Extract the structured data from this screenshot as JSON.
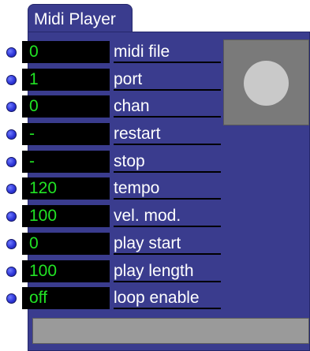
{
  "module": {
    "title": "Midi Player"
  },
  "parameters": [
    {
      "value": "0",
      "label": "midi file"
    },
    {
      "value": "1",
      "label": "port"
    },
    {
      "value": "0",
      "label": "chan"
    },
    {
      "value": "-",
      "label": "restart"
    },
    {
      "value": "-",
      "label": "stop"
    },
    {
      "value": "120",
      "label": "tempo"
    },
    {
      "value": "100",
      "label": "vel. mod."
    },
    {
      "value": "0",
      "label": "play start"
    },
    {
      "value": "100",
      "label": "play length"
    },
    {
      "value": "off",
      "label": "loop enable"
    }
  ],
  "colors": {
    "panel": "#3a3c8e",
    "value_text": "#21e324",
    "value_background": "#000000",
    "label_text": "#ffffff",
    "port_dot": "#2e36d8"
  },
  "icons": {
    "play_button": "circle-icon"
  }
}
